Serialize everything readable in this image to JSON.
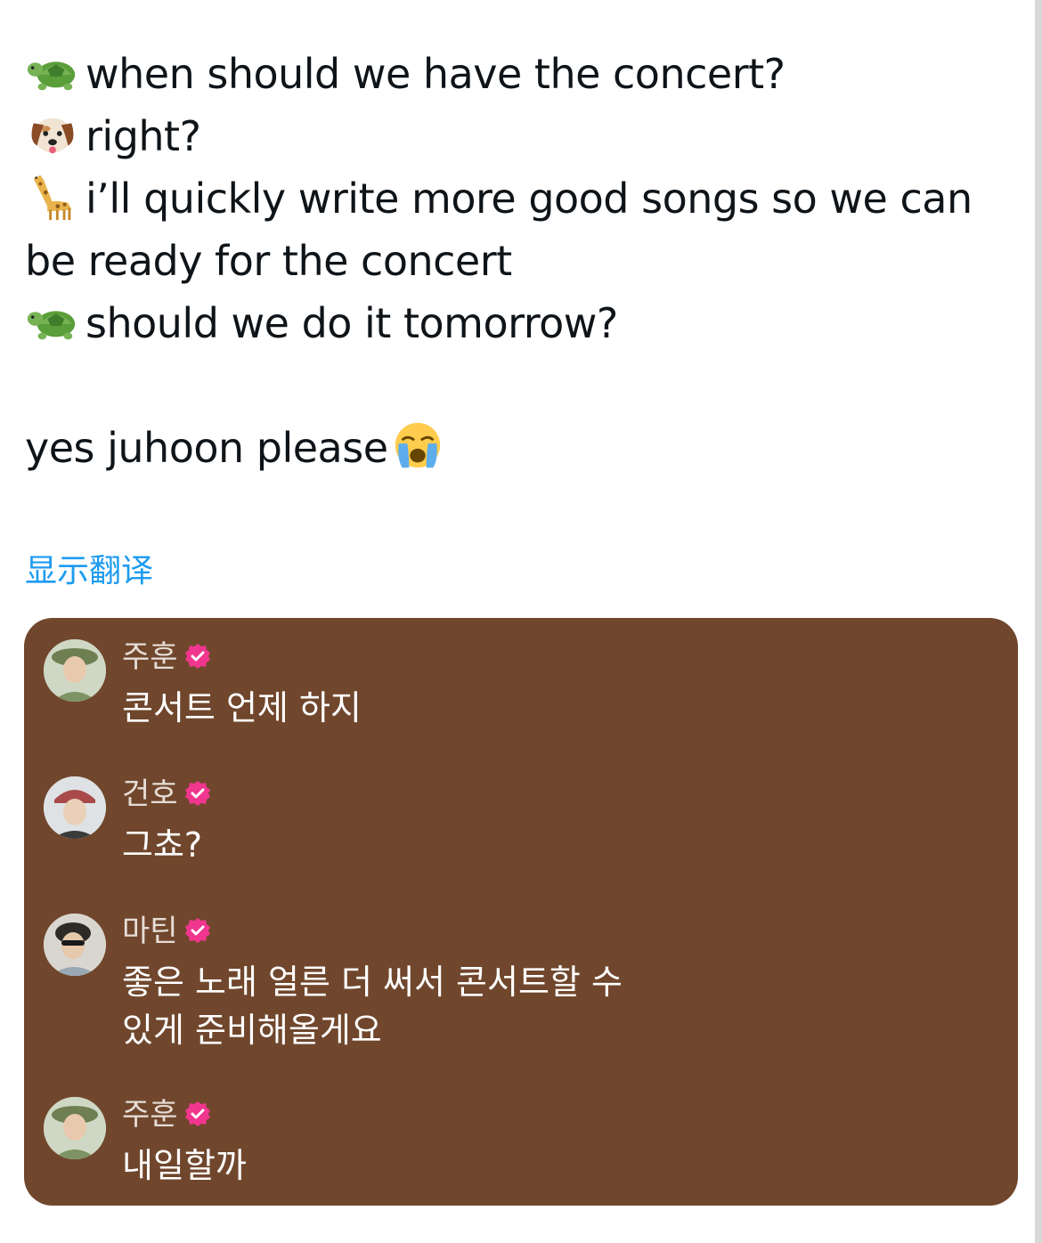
{
  "tweet": {
    "lines": [
      {
        "emoji": "turtle-icon",
        "text": "when should we have the concert?"
      },
      {
        "emoji": "dog-face-icon",
        "text": "right?"
      },
      {
        "emoji": "giraffe-icon",
        "text": "i’ll quickly write more good songs so we can"
      },
      {
        "emoji": "",
        "text": "be ready for the concert"
      },
      {
        "emoji": "turtle-icon",
        "text": "should we do it tomorrow?"
      }
    ],
    "closing": {
      "text": "yes juhoon please",
      "emoji": "loudly-crying-face-icon"
    },
    "translate_label": "显示翻译"
  },
  "chat": {
    "background": "#70472d",
    "verified_color": "#f0368e",
    "messages": [
      {
        "sender": "주훈",
        "lines": [
          "콘서트 언제 하지"
        ]
      },
      {
        "sender": "건호",
        "lines": [
          "그쵸?"
        ]
      },
      {
        "sender": "마틴",
        "lines": [
          "좋은 노래 얼른 더 써서 콘서트할 수",
          "있게 준비해올게요"
        ]
      },
      {
        "sender": "주훈",
        "lines": [
          "내일할까"
        ]
      }
    ]
  }
}
